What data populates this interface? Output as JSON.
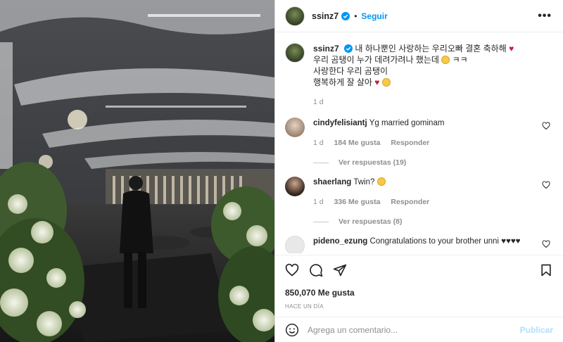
{
  "header": {
    "username": "ssinz7",
    "separator": "•",
    "follow_label": "Seguir",
    "more_label": "•••"
  },
  "caption": {
    "username": "ssinz7",
    "line1": "내 하나뿐인 사랑하는 우리오빠 결혼 축하해",
    "line2": "우리 곰탱이 누가 데려가려나 했는데",
    "line2_suffix": "ㅋㅋ",
    "line3": "사랑한다 우리 곰탱이",
    "line4": "행복하게 잘 살아",
    "time": "1 d"
  },
  "comments": [
    {
      "username": "cindyfelisiantj",
      "text": "Yg married gominam",
      "time": "1 d",
      "likes": "184 Me gusta",
      "reply_label": "Responder",
      "view_replies": "Ver respuestas (19)"
    },
    {
      "username": "shaerlang",
      "text": "Twin?",
      "time": "1 d",
      "likes": "336 Me gusta",
      "reply_label": "Responder",
      "view_replies": "Ver respuestas (8)"
    },
    {
      "username": "pideno_ezung",
      "text": "Congratulations to your brother unni ♥♥♥♥"
    }
  ],
  "actions": {
    "likes": "850,070 Me gusta",
    "time": "HACE UN DÍA"
  },
  "add_comment": {
    "placeholder": "Agrega un comentario...",
    "publish_label": "Publicar"
  },
  "colors": {
    "accent": "#0095f6",
    "publish_disabled": "#b2dffc",
    "muted": "#8e8e8e",
    "text": "#262626"
  }
}
